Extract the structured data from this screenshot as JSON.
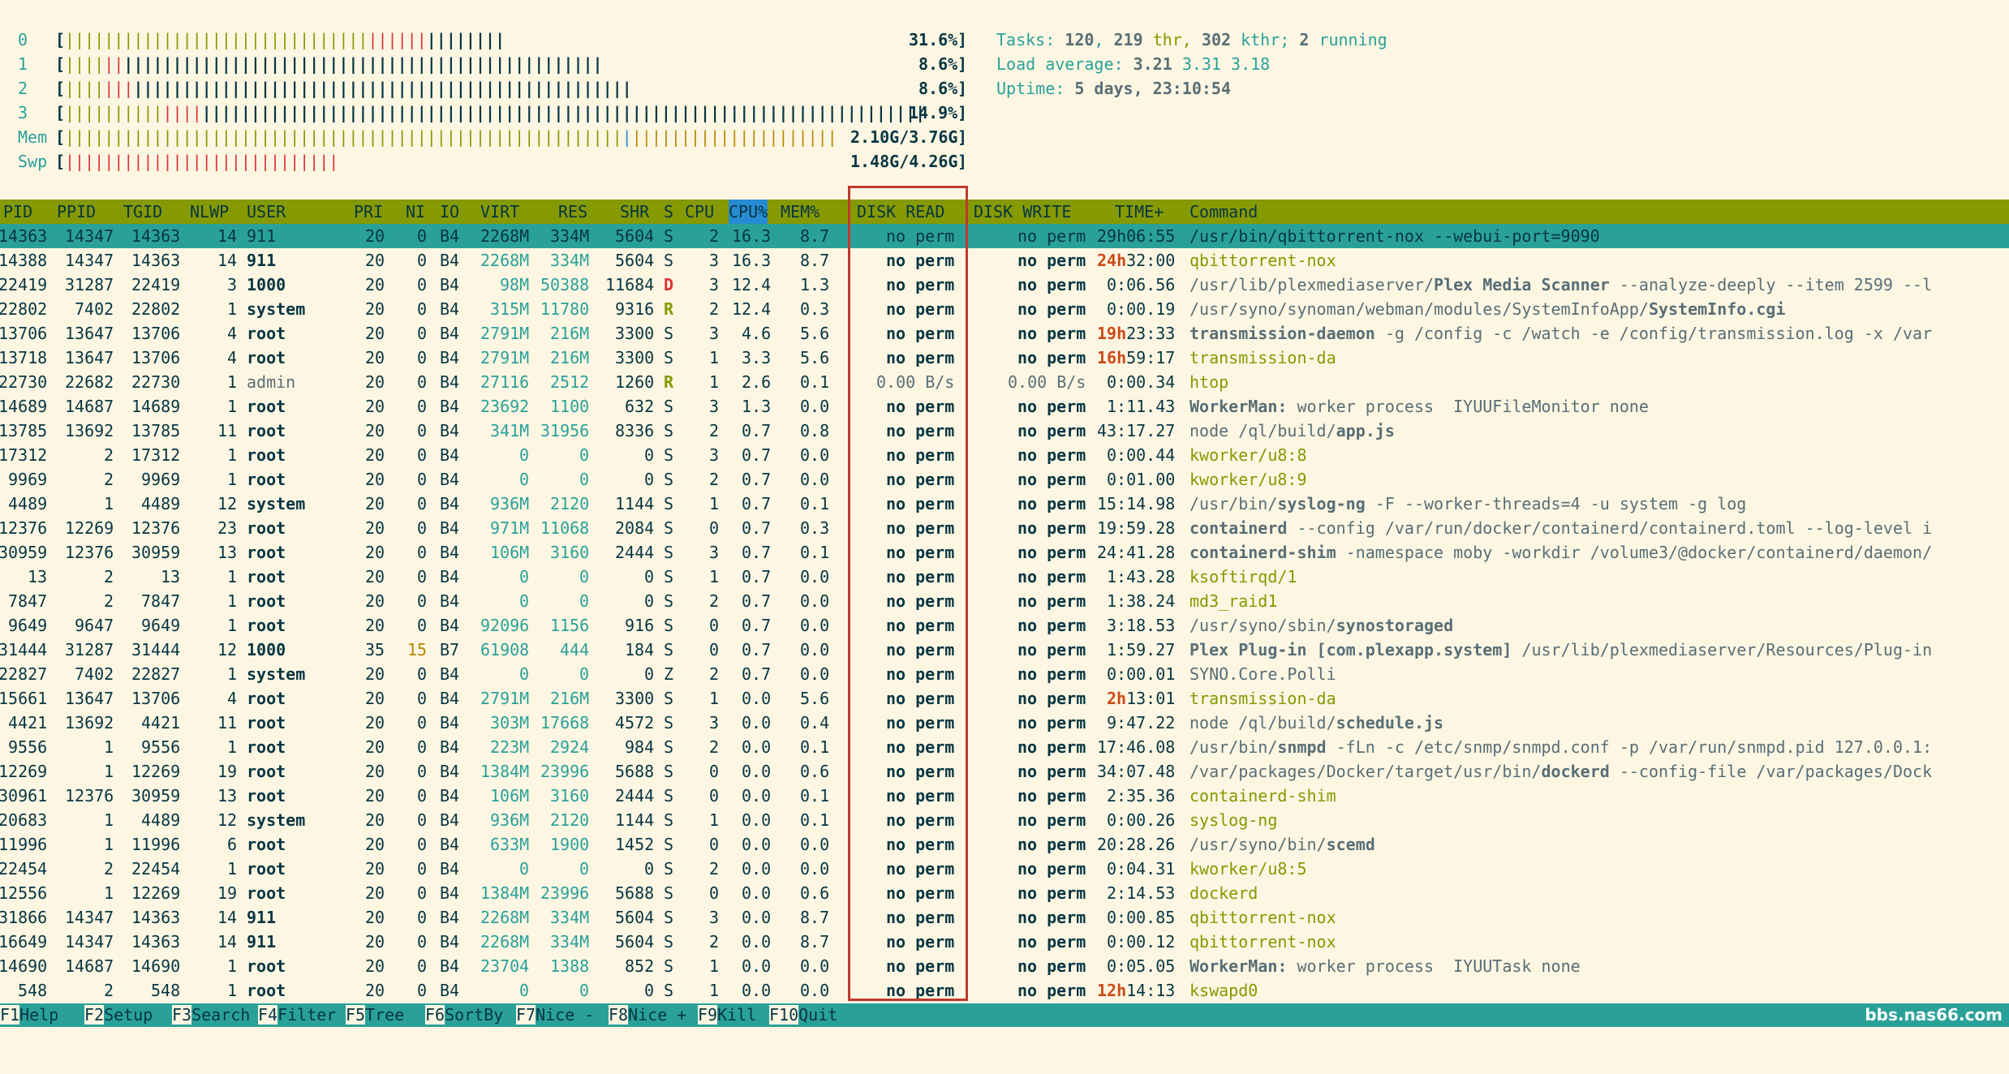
{
  "meters": [
    {
      "label": "0",
      "bar": "||||||||||||||||||||||||||||||||||||||||||||||",
      "value": "31.6%"
    },
    {
      "label": "1",
      "bar": "||||||||||||||||||||||||||||||||||||||||||||||||||||||||",
      "value": "8.6%"
    },
    {
      "label": "2",
      "bar": "|||||||||||||||||||||||||||||||||||||||||||||||||||||||||||",
      "value": "8.6%"
    },
    {
      "label": "3",
      "bar": "||||||||||||||||||||||||||||||||||||||||||||||||||||||||||||||||||||||||||||||||||||||||||||||||||||||||||||||||||||||||||",
      "value": "14.9%"
    },
    {
      "label": "Mem",
      "bar": "|||||||||||||||||||||||||||||||||||||||||||||||||||||||||||||||||||||||||||||||||",
      "value": "2.10G/3.76G"
    },
    {
      "label": "Swp",
      "bar": "||||||||||||||||||||||||||||",
      "value": "1.48G/4.26G"
    }
  ],
  "info": {
    "tasks_label": "Tasks:",
    "tasks": "120",
    "thr": "219",
    "thr_label": "thr,",
    "kthr": "302",
    "kthr_label": "kthr;",
    "running": "2",
    "running_label": "running",
    "load_label": "Load average:",
    "load1": "3.21",
    "load5": "3.31",
    "load15": "3.18",
    "uptime_label": "Uptime:",
    "uptime": "5 days, 23:10:54"
  },
  "columns": {
    "pid": "PID",
    "ppid": "PPID",
    "tgid": "TGID",
    "nlwp": "NLWP",
    "user": "USER",
    "pri": "PRI",
    "ni": "NI",
    "io": "IO",
    "virt": "VIRT",
    "res": "RES",
    "shr": "SHR",
    "s": "S",
    "cpu": "CPU",
    "cpup": "CPU%",
    "mem": "MEM%",
    "dread": "DISK READ",
    "dwrite": "DISK WRITE",
    "time": "TIME+",
    "cmd": "Command"
  },
  "processes": [
    {
      "pid": "14363",
      "ppid": "14347",
      "tgid": "14363",
      "nlwp": "14",
      "user": "911",
      "pri": "20",
      "ni": "0",
      "io": "B4",
      "virt": "2268M",
      "res": "334M",
      "shr": "5604",
      "s": "S",
      "cpu": "2",
      "cpup": "16.3",
      "mem": "8.7",
      "dread": "no perm",
      "dwrite": "no perm",
      "time_h": "",
      "time": "29h06:55",
      "cmd_pre": "",
      "cmd_bold": "",
      "cmd": "/usr/bin/qbittorrent-nox --webui-port=9090",
      "selected": true
    },
    {
      "pid": "14388",
      "ppid": "14347",
      "tgid": "14363",
      "nlwp": "14",
      "user": "911",
      "pri": "20",
      "ni": "0",
      "io": "B4",
      "virt": "2268M",
      "res": "334M",
      "shr": "5604",
      "s": "S",
      "cpu": "3",
      "cpup": "16.3",
      "mem": "8.7",
      "dread": "no perm",
      "dwrite": "no perm",
      "time_h": "24h",
      "time": "32:00",
      "cmd_pre": "",
      "cmd_bold": "",
      "cmd": "qbittorrent-nox",
      "green": true
    },
    {
      "pid": "22419",
      "ppid": "31287",
      "tgid": "22419",
      "nlwp": "3",
      "user": "1000",
      "pri": "20",
      "ni": "0",
      "io": "B4",
      "virt": "98M",
      "res": "50388",
      "shr": "11684",
      "s": "D",
      "cpu": "3",
      "cpup": "12.4",
      "mem": "1.3",
      "dread": "no perm",
      "dwrite": "no perm",
      "time_h": "",
      "time": "0:06.56",
      "cmd_pre": "/usr/lib/plexmediaserver/",
      "cmd_bold": "Plex Media Scanner",
      "cmd": " --analyze-deeply --item 2599 --l"
    },
    {
      "pid": "22802",
      "ppid": "7402",
      "tgid": "22802",
      "nlwp": "1",
      "user": "system",
      "pri": "20",
      "ni": "0",
      "io": "B4",
      "virt": "315M",
      "res": "11780",
      "shr": "9316",
      "s": "R",
      "cpu": "2",
      "cpup": "12.4",
      "mem": "0.3",
      "dread": "no perm",
      "dwrite": "no perm",
      "time_h": "",
      "time": "0:00.19",
      "cmd_pre": "/usr/syno/synoman/webman/modules/SystemInfoApp/",
      "cmd_bold": "SystemInfo.cgi",
      "cmd": ""
    },
    {
      "pid": "13706",
      "ppid": "13647",
      "tgid": "13706",
      "nlwp": "4",
      "user": "root",
      "pri": "20",
      "ni": "0",
      "io": "B4",
      "virt": "2791M",
      "res": "216M",
      "shr": "3300",
      "s": "S",
      "cpu": "3",
      "cpup": "4.6",
      "mem": "5.6",
      "dread": "no perm",
      "dwrite": "no perm",
      "time_h": "19h",
      "time": "23:33",
      "cmd_pre": "",
      "cmd_bold": "transmission-daemon",
      "cmd": " -g /config -c /watch -e /config/transmission.log -x /var"
    },
    {
      "pid": "13718",
      "ppid": "13647",
      "tgid": "13706",
      "nlwp": "4",
      "user": "root",
      "pri": "20",
      "ni": "0",
      "io": "B4",
      "virt": "2791M",
      "res": "216M",
      "shr": "3300",
      "s": "S",
      "cpu": "1",
      "cpup": "3.3",
      "mem": "5.6",
      "dread": "no perm",
      "dwrite": "no perm",
      "time_h": "16h",
      "time": "59:17",
      "cmd_pre": "",
      "cmd_bold": "",
      "cmd": "transmission-da",
      "green": true
    },
    {
      "pid": "22730",
      "ppid": "22682",
      "tgid": "22730",
      "nlwp": "1",
      "user": "admin",
      "pri": "20",
      "ni": "0",
      "io": "B4",
      "virt": "27116",
      "res": "2512",
      "shr": "1260",
      "s": "R",
      "cpu": "1",
      "cpup": "2.6",
      "mem": "0.1",
      "dread": "0.00 B/s",
      "dwrite": "0.00 B/s",
      "time_h": "",
      "time": "0:00.34",
      "cmd_pre": "",
      "cmd_bold": "htop",
      "cmd": "",
      "normuser": true,
      "plain": true
    },
    {
      "pid": "14689",
      "ppid": "14687",
      "tgid": "14689",
      "nlwp": "1",
      "user": "root",
      "pri": "20",
      "ni": "0",
      "io": "B4",
      "virt": "23692",
      "res": "1100",
      "shr": "632",
      "s": "S",
      "cpu": "3",
      "cpup": "1.3",
      "mem": "0.0",
      "dread": "no perm",
      "dwrite": "no perm",
      "time_h": "",
      "time": "1:11.43",
      "cmd_pre": "",
      "cmd_bold": "WorkerMan:",
      "cmd": " worker process  IYUUFileMonitor none"
    },
    {
      "pid": "13785",
      "ppid": "13692",
      "tgid": "13785",
      "nlwp": "11",
      "user": "root",
      "pri": "20",
      "ni": "0",
      "io": "B4",
      "virt": "341M",
      "res": "31956",
      "shr": "8336",
      "s": "S",
      "cpu": "2",
      "cpup": "0.7",
      "mem": "0.8",
      "dread": "no perm",
      "dwrite": "no perm",
      "time_h": "",
      "time": "43:17.27",
      "cmd_pre": "node /ql/build/",
      "cmd_bold": "app.js",
      "cmd": ""
    },
    {
      "pid": "17312",
      "ppid": "2",
      "tgid": "17312",
      "nlwp": "1",
      "user": "root",
      "pri": "20",
      "ni": "0",
      "io": "B4",
      "virt": "0",
      "res": "0",
      "shr": "0",
      "s": "S",
      "cpu": "3",
      "cpup": "0.7",
      "mem": "0.0",
      "dread": "no perm",
      "dwrite": "no perm",
      "time_h": "",
      "time": "0:00.44",
      "cmd_pre": "",
      "cmd_bold": "",
      "cmd": "kworker/u8:8",
      "green": true
    },
    {
      "pid": "9969",
      "ppid": "2",
      "tgid": "9969",
      "nlwp": "1",
      "user": "root",
      "pri": "20",
      "ni": "0",
      "io": "B4",
      "virt": "0",
      "res": "0",
      "shr": "0",
      "s": "S",
      "cpu": "2",
      "cpup": "0.7",
      "mem": "0.0",
      "dread": "no perm",
      "dwrite": "no perm",
      "time_h": "",
      "time": "0:01.00",
      "cmd_pre": "",
      "cmd_bold": "",
      "cmd": "kworker/u8:9",
      "green": true
    },
    {
      "pid": "4489",
      "ppid": "1",
      "tgid": "4489",
      "nlwp": "12",
      "user": "system",
      "pri": "20",
      "ni": "0",
      "io": "B4",
      "virt": "936M",
      "res": "2120",
      "shr": "1144",
      "s": "S",
      "cpu": "1",
      "cpup": "0.7",
      "mem": "0.1",
      "dread": "no perm",
      "dwrite": "no perm",
      "time_h": "",
      "time": "15:14.98",
      "cmd_pre": "/usr/bin/",
      "cmd_bold": "syslog-ng",
      "cmd": " -F --worker-threads=4 -u system -g log"
    },
    {
      "pid": "12376",
      "ppid": "12269",
      "tgid": "12376",
      "nlwp": "23",
      "user": "root",
      "pri": "20",
      "ni": "0",
      "io": "B4",
      "virt": "971M",
      "res": "11068",
      "shr": "2084",
      "s": "S",
      "cpu": "0",
      "cpup": "0.7",
      "mem": "0.3",
      "dread": "no perm",
      "dwrite": "no perm",
      "time_h": "",
      "time": "19:59.28",
      "cmd_pre": "",
      "cmd_bold": "containerd",
      "cmd": " --config /var/run/docker/containerd/containerd.toml --log-level i"
    },
    {
      "pid": "30959",
      "ppid": "12376",
      "tgid": "30959",
      "nlwp": "13",
      "user": "root",
      "pri": "20",
      "ni": "0",
      "io": "B4",
      "virt": "106M",
      "res": "3160",
      "shr": "2444",
      "s": "S",
      "cpu": "3",
      "cpup": "0.7",
      "mem": "0.1",
      "dread": "no perm",
      "dwrite": "no perm",
      "time_h": "",
      "time": "24:41.28",
      "cmd_pre": "",
      "cmd_bold": "containerd-shim",
      "cmd": " -namespace moby -workdir /volume3/@docker/containerd/daemon/"
    },
    {
      "pid": "13",
      "ppid": "2",
      "tgid": "13",
      "nlwp": "1",
      "user": "root",
      "pri": "20",
      "ni": "0",
      "io": "B4",
      "virt": "0",
      "res": "0",
      "shr": "0",
      "s": "S",
      "cpu": "1",
      "cpup": "0.7",
      "mem": "0.0",
      "dread": "no perm",
      "dwrite": "no perm",
      "time_h": "",
      "time": "1:43.28",
      "cmd_pre": "",
      "cmd_bold": "",
      "cmd": "ksoftirqd/1",
      "green": true
    },
    {
      "pid": "7847",
      "ppid": "2",
      "tgid": "7847",
      "nlwp": "1",
      "user": "root",
      "pri": "20",
      "ni": "0",
      "io": "B4",
      "virt": "0",
      "res": "0",
      "shr": "0",
      "s": "S",
      "cpu": "2",
      "cpup": "0.7",
      "mem": "0.0",
      "dread": "no perm",
      "dwrite": "no perm",
      "time_h": "",
      "time": "1:38.24",
      "cmd_pre": "",
      "cmd_bold": "",
      "cmd": "md3_raid1",
      "green": true
    },
    {
      "pid": "9649",
      "ppid": "9647",
      "tgid": "9649",
      "nlwp": "1",
      "user": "root",
      "pri": "20",
      "ni": "0",
      "io": "B4",
      "virt": "92096",
      "res": "1156",
      "shr": "916",
      "s": "S",
      "cpu": "0",
      "cpup": "0.7",
      "mem": "0.0",
      "dread": "no perm",
      "dwrite": "no perm",
      "time_h": "",
      "time": "3:18.53",
      "cmd_pre": "/usr/syno/sbin/",
      "cmd_bold": "synostoraged",
      "cmd": ""
    },
    {
      "pid": "31444",
      "ppid": "31287",
      "tgid": "31444",
      "nlwp": "12",
      "user": "1000",
      "pri": "35",
      "ni": "15",
      "io": "B7",
      "virt": "61908",
      "res": "444",
      "shr": "184",
      "s": "S",
      "cpu": "0",
      "cpup": "0.7",
      "mem": "0.0",
      "dread": "no perm",
      "dwrite": "no perm",
      "time_h": "",
      "time": "1:59.27",
      "cmd_pre": "",
      "cmd_bold": "Plex Plug-in [com.plexapp.system]",
      "cmd": " /usr/lib/plexmediaserver/Resources/Plug-in"
    },
    {
      "pid": "22827",
      "ppid": "7402",
      "tgid": "22827",
      "nlwp": "1",
      "user": "system",
      "pri": "20",
      "ni": "0",
      "io": "B4",
      "virt": "0",
      "res": "0",
      "shr": "0",
      "s": "Z",
      "cpu": "2",
      "cpup": "0.7",
      "mem": "0.0",
      "dread": "no perm",
      "dwrite": "no perm",
      "time_h": "",
      "time": "0:00.01",
      "cmd_pre": "",
      "cmd_bold": "",
      "cmd": "SYNO.Core.Polli",
      "plaincmd": true
    },
    {
      "pid": "15661",
      "ppid": "13647",
      "tgid": "13706",
      "nlwp": "4",
      "user": "root",
      "pri": "20",
      "ni": "0",
      "io": "B4",
      "virt": "2791M",
      "res": "216M",
      "shr": "3300",
      "s": "S",
      "cpu": "1",
      "cpup": "0.0",
      "mem": "5.6",
      "dread": "no perm",
      "dwrite": "no perm",
      "time_h": "2h",
      "time": "13:01",
      "cmd_pre": "",
      "cmd_bold": "",
      "cmd": "transmission-da",
      "green": true
    },
    {
      "pid": "4421",
      "ppid": "13692",
      "tgid": "4421",
      "nlwp": "11",
      "user": "root",
      "pri": "20",
      "ni": "0",
      "io": "B4",
      "virt": "303M",
      "res": "17668",
      "shr": "4572",
      "s": "S",
      "cpu": "3",
      "cpup": "0.0",
      "mem": "0.4",
      "dread": "no perm",
      "dwrite": "no perm",
      "time_h": "",
      "time": "9:47.22",
      "cmd_pre": "node /ql/build/",
      "cmd_bold": "schedule.js",
      "cmd": ""
    },
    {
      "pid": "9556",
      "ppid": "1",
      "tgid": "9556",
      "nlwp": "1",
      "user": "root",
      "pri": "20",
      "ni": "0",
      "io": "B4",
      "virt": "223M",
      "res": "2924",
      "shr": "984",
      "s": "S",
      "cpu": "2",
      "cpup": "0.0",
      "mem": "0.1",
      "dread": "no perm",
      "dwrite": "no perm",
      "time_h": "",
      "time": "17:46.08",
      "cmd_pre": "/usr/bin/",
      "cmd_bold": "snmpd",
      "cmd": " -fLn -c /etc/snmp/snmpd.conf -p /var/run/snmpd.pid 127.0.0.1:"
    },
    {
      "pid": "12269",
      "ppid": "1",
      "tgid": "12269",
      "nlwp": "19",
      "user": "root",
      "pri": "20",
      "ni": "0",
      "io": "B4",
      "virt": "1384M",
      "res": "23996",
      "shr": "5688",
      "s": "S",
      "cpu": "0",
      "cpup": "0.0",
      "mem": "0.6",
      "dread": "no perm",
      "dwrite": "no perm",
      "time_h": "",
      "time": "34:07.48",
      "cmd_pre": "/var/packages/Docker/target/usr/bin/",
      "cmd_bold": "dockerd",
      "cmd": " --config-file /var/packages/Dock"
    },
    {
      "pid": "30961",
      "ppid": "12376",
      "tgid": "30959",
      "nlwp": "13",
      "user": "root",
      "pri": "20",
      "ni": "0",
      "io": "B4",
      "virt": "106M",
      "res": "3160",
      "shr": "2444",
      "s": "S",
      "cpu": "0",
      "cpup": "0.0",
      "mem": "0.1",
      "dread": "no perm",
      "dwrite": "no perm",
      "time_h": "",
      "time": "2:35.36",
      "cmd_pre": "",
      "cmd_bold": "",
      "cmd": "containerd-shim",
      "green": true
    },
    {
      "pid": "20683",
      "ppid": "1",
      "tgid": "4489",
      "nlwp": "12",
      "user": "system",
      "pri": "20",
      "ni": "0",
      "io": "B4",
      "virt": "936M",
      "res": "2120",
      "shr": "1144",
      "s": "S",
      "cpu": "1",
      "cpup": "0.0",
      "mem": "0.1",
      "dread": "no perm",
      "dwrite": "no perm",
      "time_h": "",
      "time": "0:00.26",
      "cmd_pre": "",
      "cmd_bold": "",
      "cmd": "syslog-ng",
      "green": true
    },
    {
      "pid": "11996",
      "ppid": "1",
      "tgid": "11996",
      "nlwp": "6",
      "user": "root",
      "pri": "20",
      "ni": "0",
      "io": "B4",
      "virt": "633M",
      "res": "1900",
      "shr": "1452",
      "s": "S",
      "cpu": "0",
      "cpup": "0.0",
      "mem": "0.0",
      "dread": "no perm",
      "dwrite": "no perm",
      "time_h": "",
      "time": "20:28.26",
      "cmd_pre": "/usr/syno/bin/",
      "cmd_bold": "scemd",
      "cmd": ""
    },
    {
      "pid": "22454",
      "ppid": "2",
      "tgid": "22454",
      "nlwp": "1",
      "user": "root",
      "pri": "20",
      "ni": "0",
      "io": "B4",
      "virt": "0",
      "res": "0",
      "shr": "0",
      "s": "S",
      "cpu": "2",
      "cpup": "0.0",
      "mem": "0.0",
      "dread": "no perm",
      "dwrite": "no perm",
      "time_h": "",
      "time": "0:04.31",
      "cmd_pre": "",
      "cmd_bold": "",
      "cmd": "kworker/u8:5",
      "green": true
    },
    {
      "pid": "12556",
      "ppid": "1",
      "tgid": "12269",
      "nlwp": "19",
      "user": "root",
      "pri": "20",
      "ni": "0",
      "io": "B4",
      "virt": "1384M",
      "res": "23996",
      "shr": "5688",
      "s": "S",
      "cpu": "0",
      "cpup": "0.0",
      "mem": "0.6",
      "dread": "no perm",
      "dwrite": "no perm",
      "time_h": "",
      "time": "2:14.53",
      "cmd_pre": "",
      "cmd_bold": "",
      "cmd": "dockerd",
      "green": true
    },
    {
      "pid": "31866",
      "ppid": "14347",
      "tgid": "14363",
      "nlwp": "14",
      "user": "911",
      "pri": "20",
      "ni": "0",
      "io": "B4",
      "virt": "2268M",
      "res": "334M",
      "shr": "5604",
      "s": "S",
      "cpu": "3",
      "cpup": "0.0",
      "mem": "8.7",
      "dread": "no perm",
      "dwrite": "no perm",
      "time_h": "",
      "time": "0:00.85",
      "cmd_pre": "",
      "cmd_bold": "",
      "cmd": "qbittorrent-nox",
      "green": true
    },
    {
      "pid": "16649",
      "ppid": "14347",
      "tgid": "14363",
      "nlwp": "14",
      "user": "911",
      "pri": "20",
      "ni": "0",
      "io": "B4",
      "virt": "2268M",
      "res": "334M",
      "shr": "5604",
      "s": "S",
      "cpu": "2",
      "cpup": "0.0",
      "mem": "8.7",
      "dread": "no perm",
      "dwrite": "no perm",
      "time_h": "",
      "time": "0:00.12",
      "cmd_pre": "",
      "cmd_bold": "",
      "cmd": "qbittorrent-nox",
      "green": true
    },
    {
      "pid": "14690",
      "ppid": "14687",
      "tgid": "14690",
      "nlwp": "1",
      "user": "root",
      "pri": "20",
      "ni": "0",
      "io": "B4",
      "virt": "23704",
      "res": "1388",
      "shr": "852",
      "s": "S",
      "cpu": "1",
      "cpup": "0.0",
      "mem": "0.0",
      "dread": "no perm",
      "dwrite": "no perm",
      "time_h": "",
      "time": "0:05.05",
      "cmd_pre": "",
      "cmd_bold": "WorkerMan:",
      "cmd": " worker process  IYUUTask none"
    },
    {
      "pid": "548",
      "ppid": "2",
      "tgid": "548",
      "nlwp": "1",
      "user": "root",
      "pri": "20",
      "ni": "0",
      "io": "B4",
      "virt": "0",
      "res": "0",
      "shr": "0",
      "s": "S",
      "cpu": "1",
      "cpup": "0.0",
      "mem": "0.0",
      "dread": "no perm",
      "dwrite": "no perm",
      "time_h": "12h",
      "time": "14:13",
      "cmd_pre": "",
      "cmd_bold": "",
      "cmd": "kswapd0",
      "green": true
    }
  ],
  "footer": [
    {
      "key": "F1",
      "label": "Help"
    },
    {
      "key": "F2",
      "label": "Setup"
    },
    {
      "key": "F3",
      "label": "Search"
    },
    {
      "key": "F4",
      "label": "Filter"
    },
    {
      "key": "F5",
      "label": "Tree"
    },
    {
      "key": "F6",
      "label": "SortBy"
    },
    {
      "key": "F7",
      "label": "Nice -"
    },
    {
      "key": "F8",
      "label": "Nice +"
    },
    {
      "key": "F9",
      "label": "Kill"
    },
    {
      "key": "F10",
      "label": "Quit"
    }
  ],
  "watermark": "bbs.nas66.com"
}
